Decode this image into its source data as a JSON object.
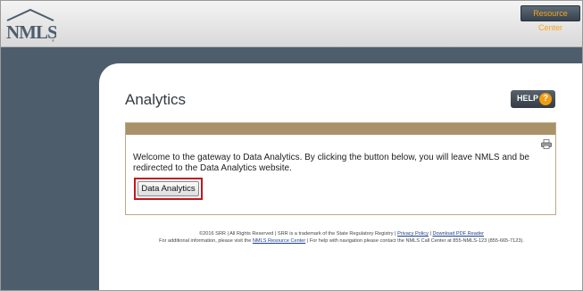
{
  "header": {
    "logo_text": "NMLS",
    "resource_center_label": "Resource Center"
  },
  "page": {
    "title": "Analytics",
    "help_label": "HELP",
    "help_icon": "?"
  },
  "panel": {
    "welcome_text": "Welcome to the gateway to Data Analytics. By clicking the button below, you will leave NMLS and be redirected to the Data Analytics website.",
    "button_label": "Data Analytics",
    "print_icon": "print-icon"
  },
  "footer": {
    "copyright": "©2016 SRR | All Rights Reserved | SRR is a trademark of the State Regulatory Registry |",
    "privacy_link": "Privacy Policy",
    "separator": "|",
    "pdf_link": "Download PDF Reader",
    "line2_prefix": "For additional information, please visit the",
    "resource_link": "NMLS Resource Center",
    "line2_suffix": "| For help with navigation please contact the NMLS Call Center at 855-NMLS-123 (855-665-7123)."
  },
  "colors": {
    "sidebar": "#4e5d6c",
    "panel_header": "#a99168",
    "highlight": "#c4161c",
    "accent": "#f39c12"
  }
}
